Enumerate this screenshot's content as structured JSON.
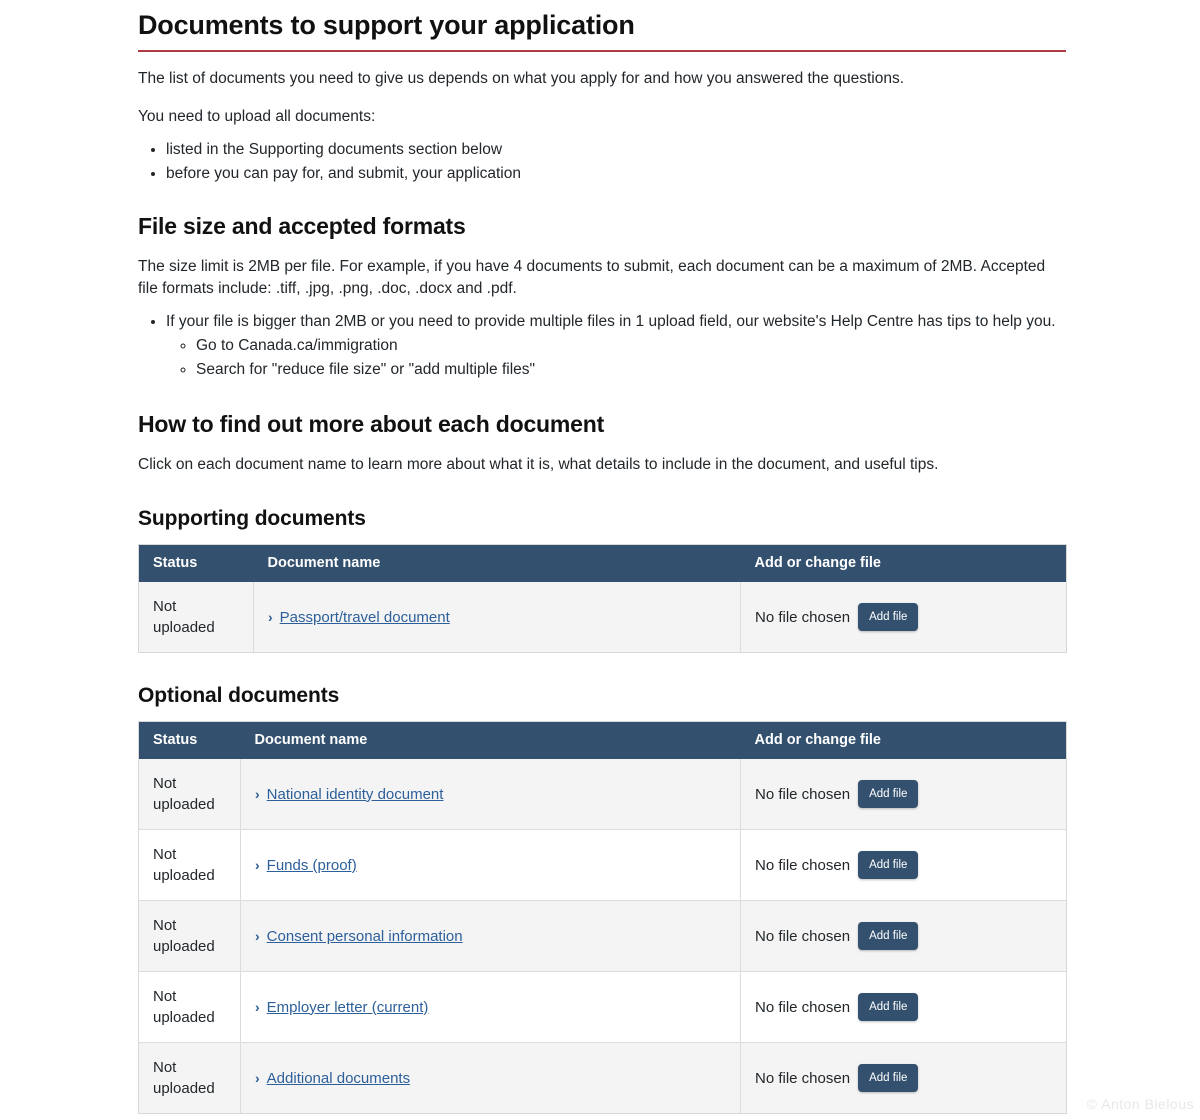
{
  "header": {
    "title": "Documents to support your application"
  },
  "intro": {
    "paragraph_1": "The list of documents you need to give us depends on what you apply for and how you answered the questions.",
    "paragraph_2": "You need to upload all documents:",
    "bullets": [
      "listed in the Supporting documents section below",
      "before you can pay for, and submit, your application"
    ]
  },
  "file_size_section": {
    "heading": "File size and accepted formats",
    "paragraph": "The size limit is 2MB per file. For example, if you have 4 documents to submit, each document can be a maximum of 2MB. Accepted file formats include: .tiff, .jpg, .png, .doc, .docx and .pdf.",
    "bullet": "If your file is bigger than 2MB or you need to provide multiple files in 1 upload field, our website's Help Centre has tips to help you.",
    "sub_bullets": [
      "Go to Canada.ca/immigration",
      "Search for \"reduce file size\" or \"add multiple files\""
    ]
  },
  "find_out_more_section": {
    "heading": "How to find out more about each document",
    "paragraph": "Click on each document name to learn more about what it is, what details to include in the document, and useful tips."
  },
  "supporting_documents": {
    "heading": "Supporting documents",
    "columns": [
      "Status",
      "Document name",
      "Add or change file"
    ],
    "rows": [
      {
        "status": "Not uploaded",
        "name": "Passport/travel document",
        "chevron": "›",
        "file_status": "No file chosen",
        "button_label": "Add file"
      }
    ]
  },
  "optional_documents": {
    "heading": "Optional documents",
    "columns": [
      "Status",
      "Document name",
      "Add or change file"
    ],
    "rows": [
      {
        "status": "Not uploaded",
        "name": "National identity document",
        "chevron": "›",
        "file_status": "No file chosen",
        "button_label": "Add file"
      },
      {
        "status": "Not uploaded",
        "name": "Funds (proof)",
        "chevron": "›",
        "file_status": "No file chosen",
        "button_label": "Add file"
      },
      {
        "status": "Not uploaded",
        "name": "Consent personal information",
        "chevron": "›",
        "file_status": "No file chosen",
        "button_label": "Add file"
      },
      {
        "status": "Not uploaded",
        "name": "Employer letter (current)",
        "chevron": "›",
        "file_status": "No file chosen",
        "button_label": "Add file"
      },
      {
        "status": "Not uploaded",
        "name": "Additional documents",
        "chevron": "›",
        "file_status": "No file chosen",
        "button_label": "Add file"
      }
    ]
  },
  "watermark": {
    "text": "© Anton Bielous"
  },
  "colors": {
    "table_header_bg": "#33506e",
    "title_rule": "#af3c43",
    "link": "#2d5f9a",
    "row_alt_bg": "#f4f4f4",
    "button_bg": "#33506e"
  }
}
